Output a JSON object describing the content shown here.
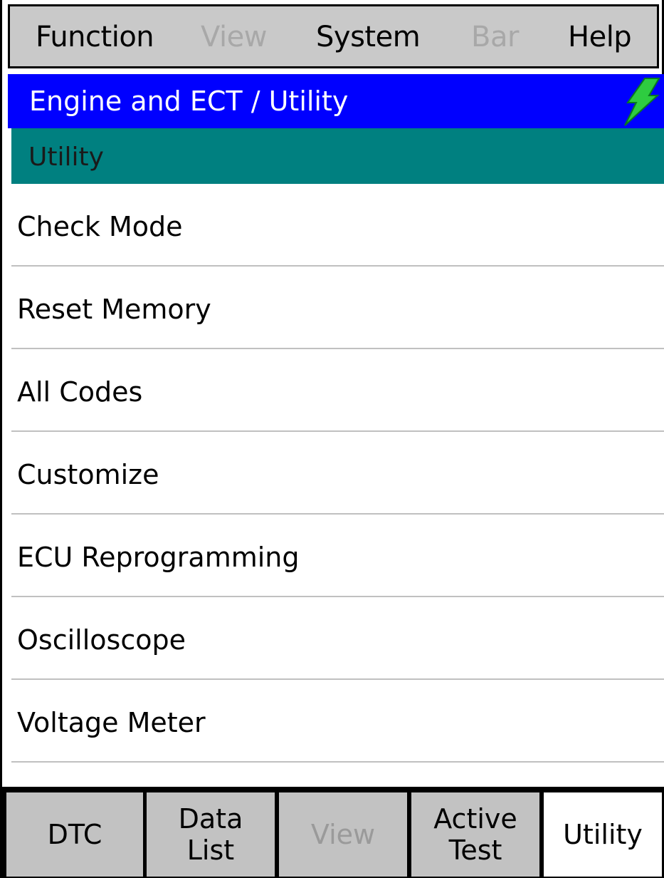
{
  "menubar": {
    "items": [
      {
        "label": "Function",
        "enabled": true
      },
      {
        "label": "View",
        "enabled": false
      },
      {
        "label": "System",
        "enabled": true
      },
      {
        "label": "Bar",
        "enabled": false
      },
      {
        "label": "Help",
        "enabled": true
      }
    ]
  },
  "header": {
    "title": "Engine and ECT / Utility",
    "status_icon": "lightning-bolt-icon",
    "status_color": "#2ecc40"
  },
  "section": {
    "title": "Utility"
  },
  "list": {
    "items": [
      {
        "label": "Check Mode"
      },
      {
        "label": "Reset Memory"
      },
      {
        "label": "All Codes"
      },
      {
        "label": "Customize"
      },
      {
        "label": "ECU Reprogramming"
      },
      {
        "label": "Oscilloscope"
      },
      {
        "label": "Voltage Meter"
      }
    ]
  },
  "tabs": {
    "items": [
      {
        "line1": "DTC",
        "line2": "",
        "enabled": true,
        "active": false
      },
      {
        "line1": "Data",
        "line2": "List",
        "enabled": true,
        "active": false
      },
      {
        "line1": "View",
        "line2": "",
        "enabled": false,
        "active": false
      },
      {
        "line1": "Active",
        "line2": "Test",
        "enabled": true,
        "active": false
      },
      {
        "line1": "Utility",
        "line2": "",
        "enabled": true,
        "active": true
      }
    ]
  },
  "colors": {
    "menubar_bg": "#c9c9c9",
    "header_bg": "#0000ff",
    "section_bg": "#008080",
    "tab_bg": "#c2c2c2",
    "tab_active_bg": "#ffffff"
  }
}
